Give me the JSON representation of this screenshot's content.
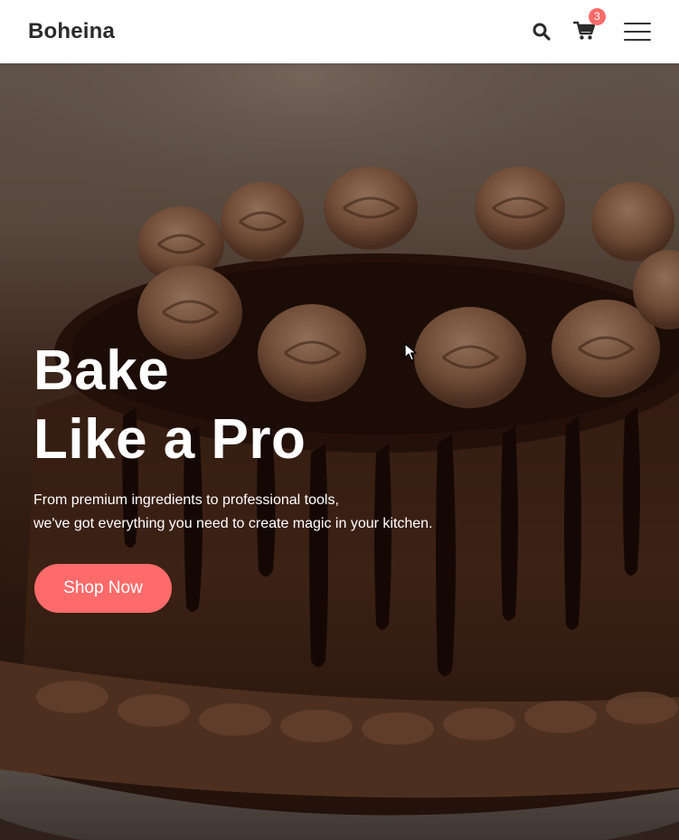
{
  "header": {
    "brand": "Boheina",
    "icons": {
      "search": "search-icon",
      "cart": "shopping-cart-icon",
      "menu": "hamburger-menu-icon"
    },
    "cart_count": "3"
  },
  "hero": {
    "title_line1": "Bake",
    "title_line2": "Like a Pro",
    "subtitle_line1": "From premium ingredients to professional tools,",
    "subtitle_line2": "we've got everything you need to create magic in your kitchen.",
    "cta_label": "Shop Now",
    "background_image": "chocolate-drip-cake-photo"
  },
  "colors": {
    "accent": "#ff6b6b",
    "header_bg": "#ffffff",
    "brand_text": "#2b2b2b",
    "hero_text": "#ffffff"
  }
}
